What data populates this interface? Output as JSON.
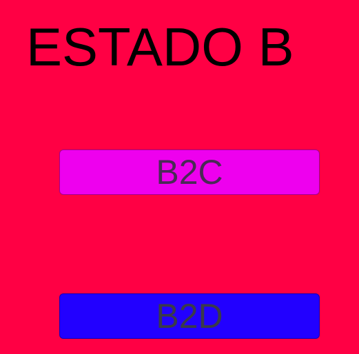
{
  "screen": {
    "title": "ESTADO B",
    "background_color": "#FF0044"
  },
  "buttons": {
    "b2c": {
      "label": "B2C",
      "color": "#EE00EE"
    },
    "b2d": {
      "label": "B2D",
      "color": "#2200FF"
    }
  }
}
